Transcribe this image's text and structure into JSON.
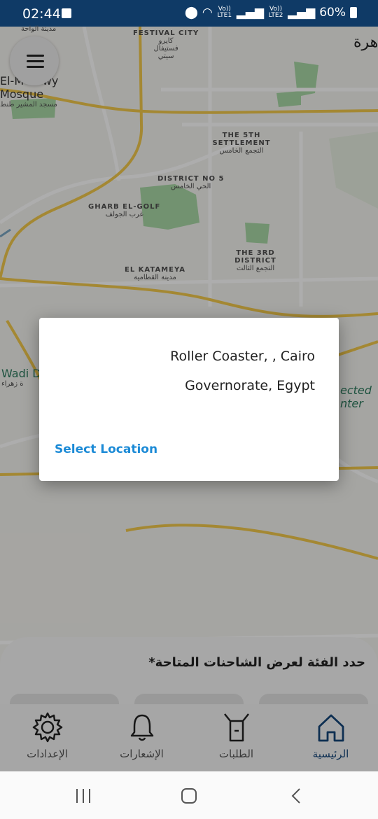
{
  "status_bar": {
    "time": "02:44",
    "lte1": "Vo)) LTE1",
    "lte2": "Vo)) LTE2",
    "battery": "60%"
  },
  "map": {
    "labels": {
      "festival_en": "FESTIVAL CITY",
      "festival_ar": "كايرو فستيفال سيتي",
      "mosque_en": "El-M    er wy Mosque",
      "mosque_ar": "مسجد المشير طنط",
      "wahat_ar": "مدينة الواحة",
      "fifth_en": "THE 5TH SETTLEMENT",
      "fifth_ar": "التجمع الخامس",
      "district5_en": "DISTRICT NO 5",
      "district5_ar": "الحي الخامس",
      "gharb_en": "GHARB EL-GOLF",
      "gharb_ar": "غرب الجولف",
      "third_en": "THE 3RD DISTRICT",
      "third_ar": "التجمع الثالث",
      "katameya_en": "EL KATAMEYA",
      "katameya_ar": "مدينة القطامية",
      "wadi_en": "Wadi D",
      "wadi_ar": "ة زهراء",
      "expected_en": "ected nter",
      "cairo_ar": "هرة"
    }
  },
  "dialog": {
    "address": "Roller Coaster, , Cairo Governorate, Egypt",
    "action": "Select Location"
  },
  "sheet": {
    "title": "حدد الفئة لعرض الشاحنات المتاحة*"
  },
  "bottom_nav": [
    {
      "label": "الإعدادات",
      "icon": "gear-icon"
    },
    {
      "label": "الإشعارات",
      "icon": "bell-icon"
    },
    {
      "label": "الطلبات",
      "icon": "box-icon"
    },
    {
      "label": "الرئيسية",
      "icon": "home-icon"
    }
  ],
  "colors": {
    "status_bar": "#0f3a66",
    "accent": "#1b8ad6",
    "active_nav": "#15467a",
    "road": "#f2c94c"
  }
}
